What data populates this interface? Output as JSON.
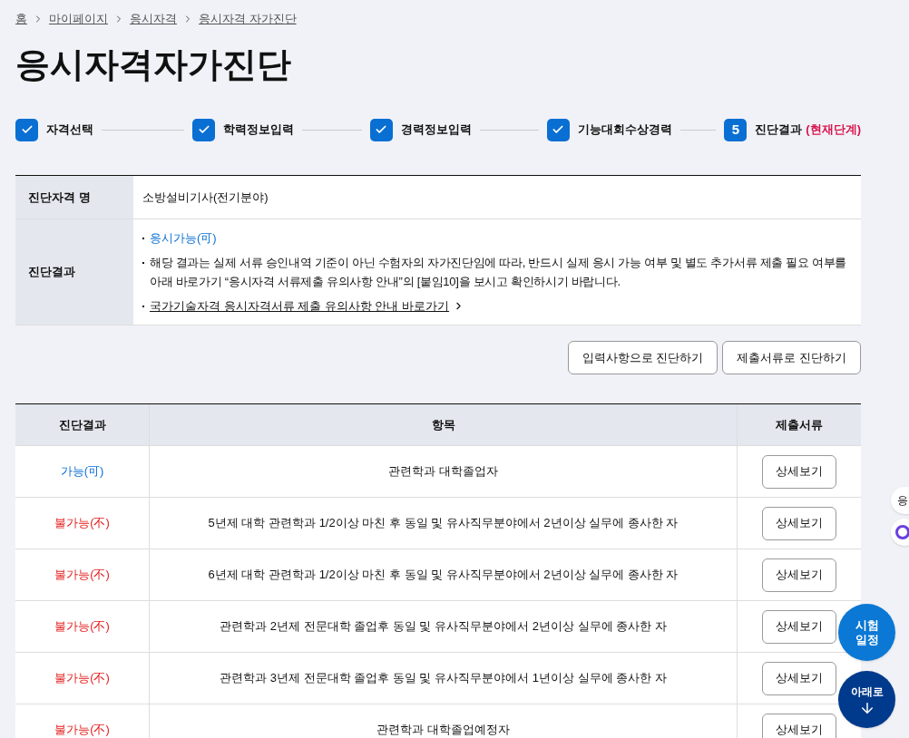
{
  "breadcrumb": [
    "홈",
    "마이페이지",
    "응시자격",
    "응시자격 자가진단"
  ],
  "title": "응시자격자가진단",
  "steps": [
    {
      "label": "자격선택",
      "done": true
    },
    {
      "label": "학력정보입력",
      "done": true
    },
    {
      "label": "경력정보입력",
      "done": true
    },
    {
      "label": "기능대회수상경력",
      "done": true
    },
    {
      "label": "진단결과",
      "done": false,
      "number": "5",
      "note": "(현재단계)"
    }
  ],
  "summary": {
    "name_label": "진단자격 명",
    "name_value": "소방설비기사(전기분야)",
    "result_label": "진단결과",
    "result_value": "응시가능(可)",
    "notice": "해당 결과는 실제 서류 승인내역 기준이 아닌 수험자의 자가진단임에 따라, 반드시 실제 응시 가능 여부 및 별도 추가서류 제출 필요 여부를 아래 바로가기 “응시자격 서류제출 유의사항 안내”의 [붙임10]을 보시고 확인하시기 바랍니다.",
    "link": "국가기술자격 응시자격서류 제출 유의사항 안내 바로가기"
  },
  "buttons": [
    "입력사항으로 진단하기",
    "제출서류로 진단하기"
  ],
  "table": {
    "columns": [
      "진단결과",
      "항목",
      "제출서류"
    ],
    "rows": [
      {
        "result": "가능(可)",
        "eligible": true,
        "item": "관련학과 대학졸업자",
        "action": "상세보기"
      },
      {
        "result": "불가능(不)",
        "eligible": false,
        "item": "5년제 대학 관련학과 1/2이상 마친 후 동일 및 유사직무분야에서 2년이상 실무에 종사한 자",
        "action": "상세보기"
      },
      {
        "result": "불가능(不)",
        "eligible": false,
        "item": "6년제 대학 관련학과 1/2이상 마친 후 동일 및 유사직무분야에서 2년이상 실무에 종사한 자",
        "action": "상세보기"
      },
      {
        "result": "불가능(不)",
        "eligible": false,
        "item": "관련학과 2년제 전문대학 졸업후 동일 및 유사직무분야에서 2년이상 실무에 종사한 자",
        "action": "상세보기"
      },
      {
        "result": "불가능(不)",
        "eligible": false,
        "item": "관련학과 3년제 전문대학 졸업후 동일 및 유사직무분야에서 1년이상 실무에 종사한 자",
        "action": "상세보기"
      },
      {
        "result": "불가능(不)",
        "eligible": false,
        "item": "관련학과 대학졸업예정자",
        "action": "상세보기"
      }
    ]
  },
  "side_tab": "응",
  "floating": [
    {
      "kind": "schedule",
      "label": "시험\n일정"
    },
    {
      "kind": "down",
      "label": "아래로"
    }
  ]
}
